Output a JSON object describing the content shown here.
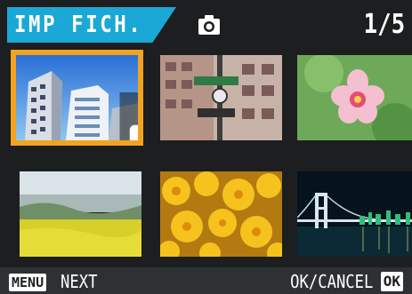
{
  "header": {
    "mode_label": "IMP FICH.",
    "mode_icon": "camera-icon",
    "page_counter": "1/5"
  },
  "thumbnails": [
    {
      "subject": "building",
      "selected": true,
      "print_marked": true
    },
    {
      "subject": "street-sign",
      "selected": false,
      "print_marked": false
    },
    {
      "subject": "flower",
      "selected": false,
      "print_marked": false
    },
    {
      "subject": "field-landscape",
      "selected": false,
      "print_marked": false
    },
    {
      "subject": "yellow-flowers",
      "selected": false,
      "print_marked": false
    },
    {
      "subject": "night-bridge",
      "selected": false,
      "print_marked": false
    }
  ],
  "footer": {
    "menu_key": "MENU",
    "next_label": "NEXT",
    "cancel_label": "OK/CANCEL",
    "ok_key": "OK"
  },
  "colors": {
    "accent": "#1aa8d6",
    "selection": "#f2a322",
    "background": "#1c1e20"
  }
}
